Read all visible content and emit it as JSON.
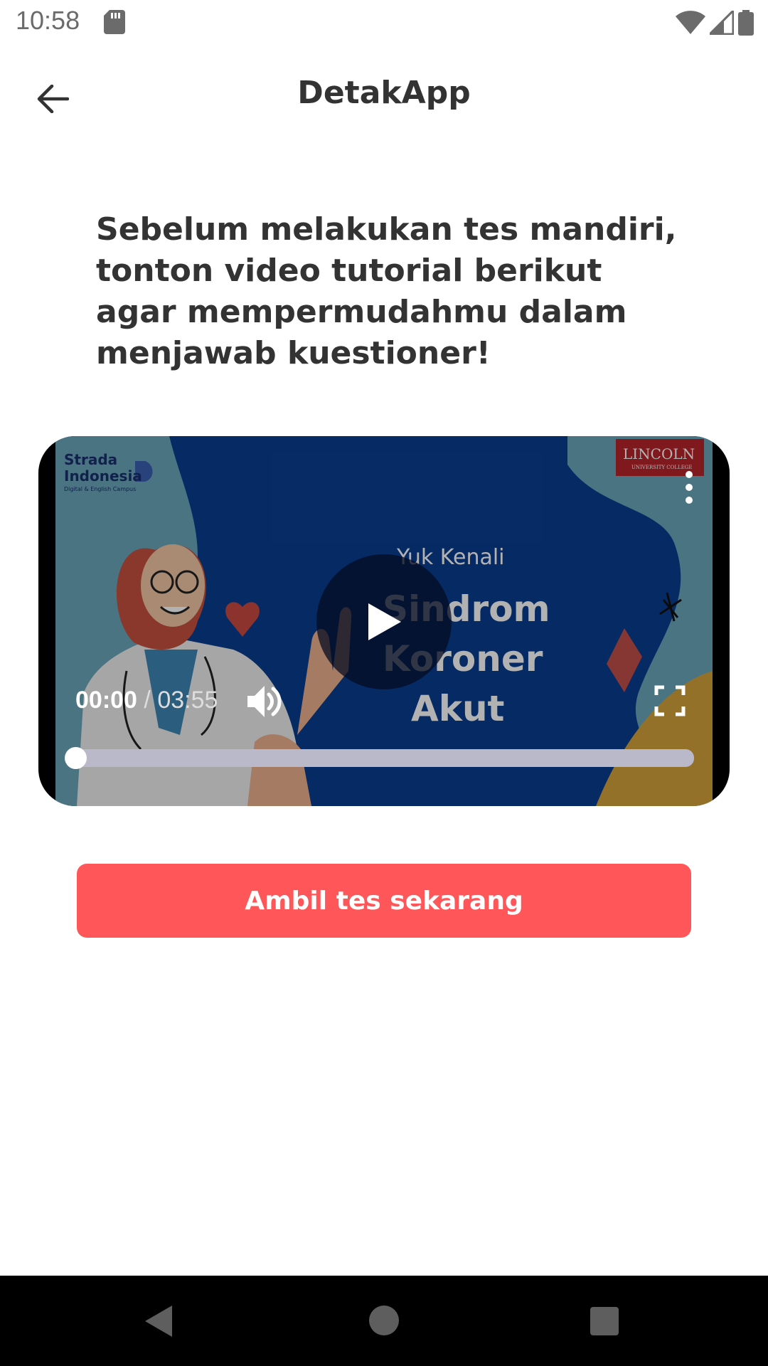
{
  "status_bar": {
    "time": "10:58",
    "icons": [
      "sd-card-icon",
      "wifi-icon",
      "signal-icon",
      "battery-icon"
    ]
  },
  "app_bar": {
    "title": "DetakApp",
    "back_icon": "arrow-back-icon"
  },
  "intro_text": "Sebelum melakukan tes mandiri, tonton video tutorial berikut agar mempermudahmu dalam menjawab kuestioner!",
  "video": {
    "thumbnail": {
      "brand_line1": "Strada",
      "brand_line2": "Indonesia",
      "brand_sub": "Digital & English Campus",
      "partner_name": "LINCOLN",
      "partner_sub": "UNIVERSITY COLLEGE",
      "kicker": "Yuk Kenali",
      "title_line1": "Sindrom",
      "title_line2": "Koroner",
      "title_line3": "Akut"
    },
    "current_time": "00:00",
    "separator": " / ",
    "duration": "03:55",
    "progress_fraction": 0,
    "play_icon": "play-icon",
    "volume_icon": "volume-icon",
    "fullscreen_icon": "fullscreen-icon",
    "more_icon": "more-vert-icon"
  },
  "cta": {
    "label": "Ambil tes sekarang",
    "color": "#ff5759"
  },
  "nav_bar": {
    "icons": [
      "nav-back-icon",
      "nav-home-icon",
      "nav-recents-icon"
    ]
  }
}
